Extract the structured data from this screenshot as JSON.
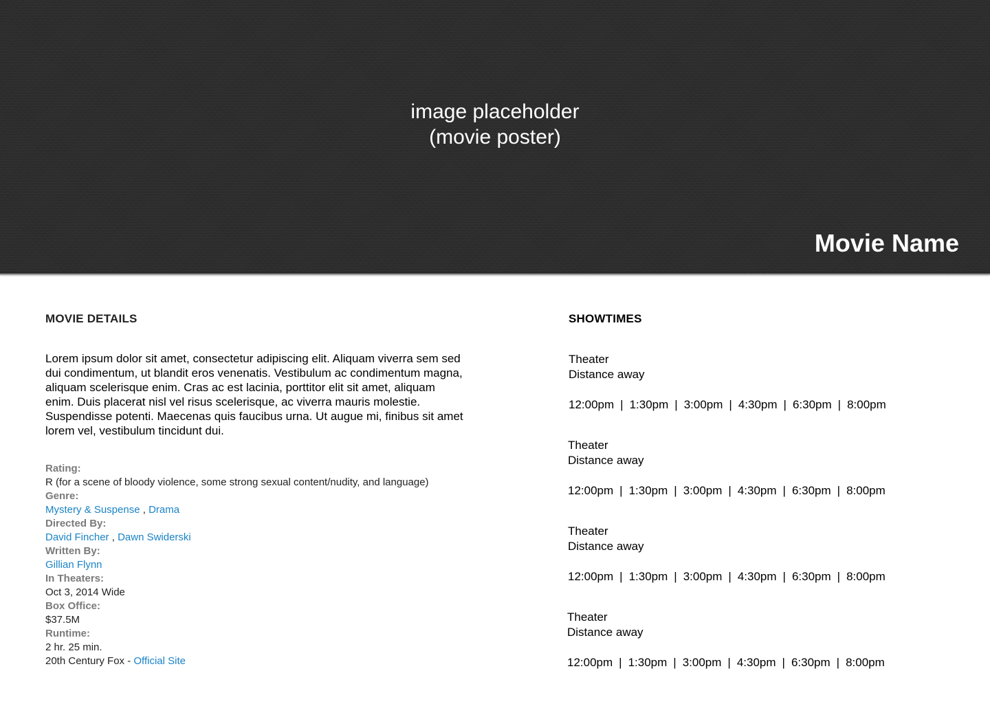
{
  "hero": {
    "placeholder_line1": "image placeholder",
    "placeholder_line2": "(movie poster)",
    "title": "Movie Name"
  },
  "details": {
    "heading": "MOVIE DETAILS",
    "synopsis": "Lorem ipsum dolor sit amet, consectetur adipiscing elit. Aliquam viverra sem sed dui condimentum, ut blandit eros venenatis. Vestibulum ac condimentum magna, aliquam scelerisque enim. Cras ac est lacinia, porttitor elit sit amet, aliquam enim. Duis placerat nisl vel risus scelerisque, ac viverra mauris molestie. Suspendisse potenti. Maecenas quis faucibus urna. Ut augue mi, finibus sit amet lorem vel, vestibulum tincidunt dui.",
    "rating_label": "Rating:",
    "rating_value": "R (for a scene of bloody violence, some strong sexual content/nudity, and language)",
    "genre_label": "Genre:",
    "genres": [
      "Mystery & Suspense",
      "Drama"
    ],
    "directed_label": "Directed By:",
    "directors": [
      "David Fincher",
      "Dawn Swiderski"
    ],
    "written_label": "Written By:",
    "writers": [
      "Gillian Flynn"
    ],
    "theaters_label": "In Theaters:",
    "theaters_value": "Oct 3, 2014 Wide",
    "box_office_label": "Box Office:",
    "box_office_value": "$37.5M",
    "runtime_label": "Runtime:",
    "runtime_value": "2 hr. 25 min.",
    "studio": "20th Century Fox -",
    "official_site": "Official Site",
    "list_separator": ","
  },
  "showtimes": {
    "heading": "SHOWTIMES",
    "theaters": [
      {
        "name": "Theater",
        "distance": "Distance away",
        "times": [
          "12:00pm",
          "1:30pm",
          "3:00pm",
          "4:30pm",
          "6:30pm",
          "8:00pm"
        ]
      },
      {
        "name": "Theater",
        "distance": "Distance away",
        "times": [
          "12:00pm",
          "1:30pm",
          "3:00pm",
          "4:30pm",
          "6:30pm",
          "8:00pm"
        ]
      },
      {
        "name": "Theater",
        "distance": "Distance away",
        "times": [
          "12:00pm",
          "1:30pm",
          "3:00pm",
          "4:30pm",
          "6:30pm",
          "8:00pm"
        ]
      },
      {
        "name": "Theater",
        "distance": "Distance away",
        "times": [
          "12:00pm",
          "1:30pm",
          "3:00pm",
          "4:30pm",
          "6:30pm",
          "8:00pm"
        ]
      }
    ],
    "time_separator": "|"
  }
}
